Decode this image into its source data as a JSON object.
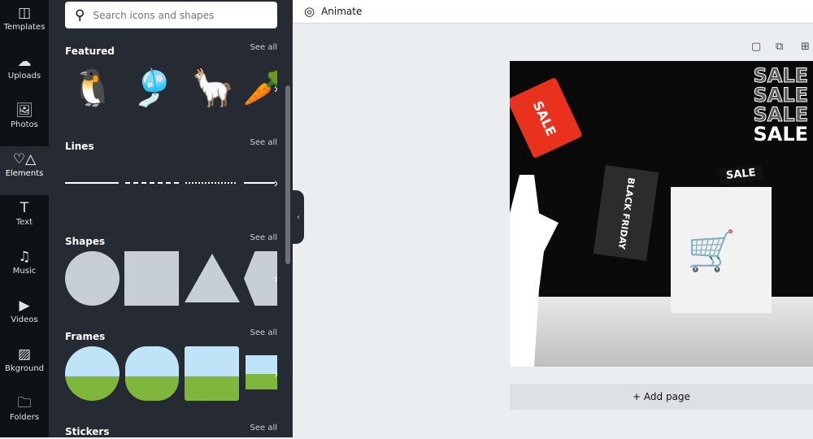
{
  "rail": [
    {
      "label": "Templates",
      "icon": "templates-icon",
      "glyph": "◫"
    },
    {
      "label": "Uploads",
      "icon": "upload-cloud-icon",
      "glyph": "☁"
    },
    {
      "label": "Photos",
      "icon": "photo-icon",
      "glyph": "🖼"
    },
    {
      "label": "Elements",
      "icon": "elements-icon",
      "glyph": "♡△"
    },
    {
      "label": "Text",
      "icon": "text-icon",
      "glyph": "T"
    },
    {
      "label": "Music",
      "icon": "music-icon",
      "glyph": "♫"
    },
    {
      "label": "Videos",
      "icon": "video-icon",
      "glyph": "▶"
    },
    {
      "label": "Bkground",
      "icon": "background-icon",
      "glyph": "▨"
    },
    {
      "label": "Folders",
      "icon": "folder-icon",
      "glyph": "🗀"
    }
  ],
  "active_tab": "Elements",
  "search": {
    "placeholder": "Search icons and shapes"
  },
  "sections": [
    {
      "title": "Featured",
      "see_all": "See all"
    },
    {
      "title": "Lines",
      "see_all": "See all"
    },
    {
      "title": "Shapes",
      "see_all": "See all"
    },
    {
      "title": "Frames",
      "see_all": "See all"
    },
    {
      "title": "Stickers",
      "see_all": "See all"
    }
  ],
  "topbar": {
    "animate": "Animate"
  },
  "canvas": {
    "sale_words": [
      "SALE",
      "SALE",
      "SALE",
      "SALE"
    ],
    "tag_text": "SALE",
    "hang_tag": "BLACK FRIDAY",
    "bag_text": "SALE"
  },
  "add_page": "+ Add page",
  "colors": {
    "rail": "#0e1217",
    "panel": "#252a33",
    "canvas_bg": "#ebeef1",
    "sale_tag": "#e8321e"
  }
}
